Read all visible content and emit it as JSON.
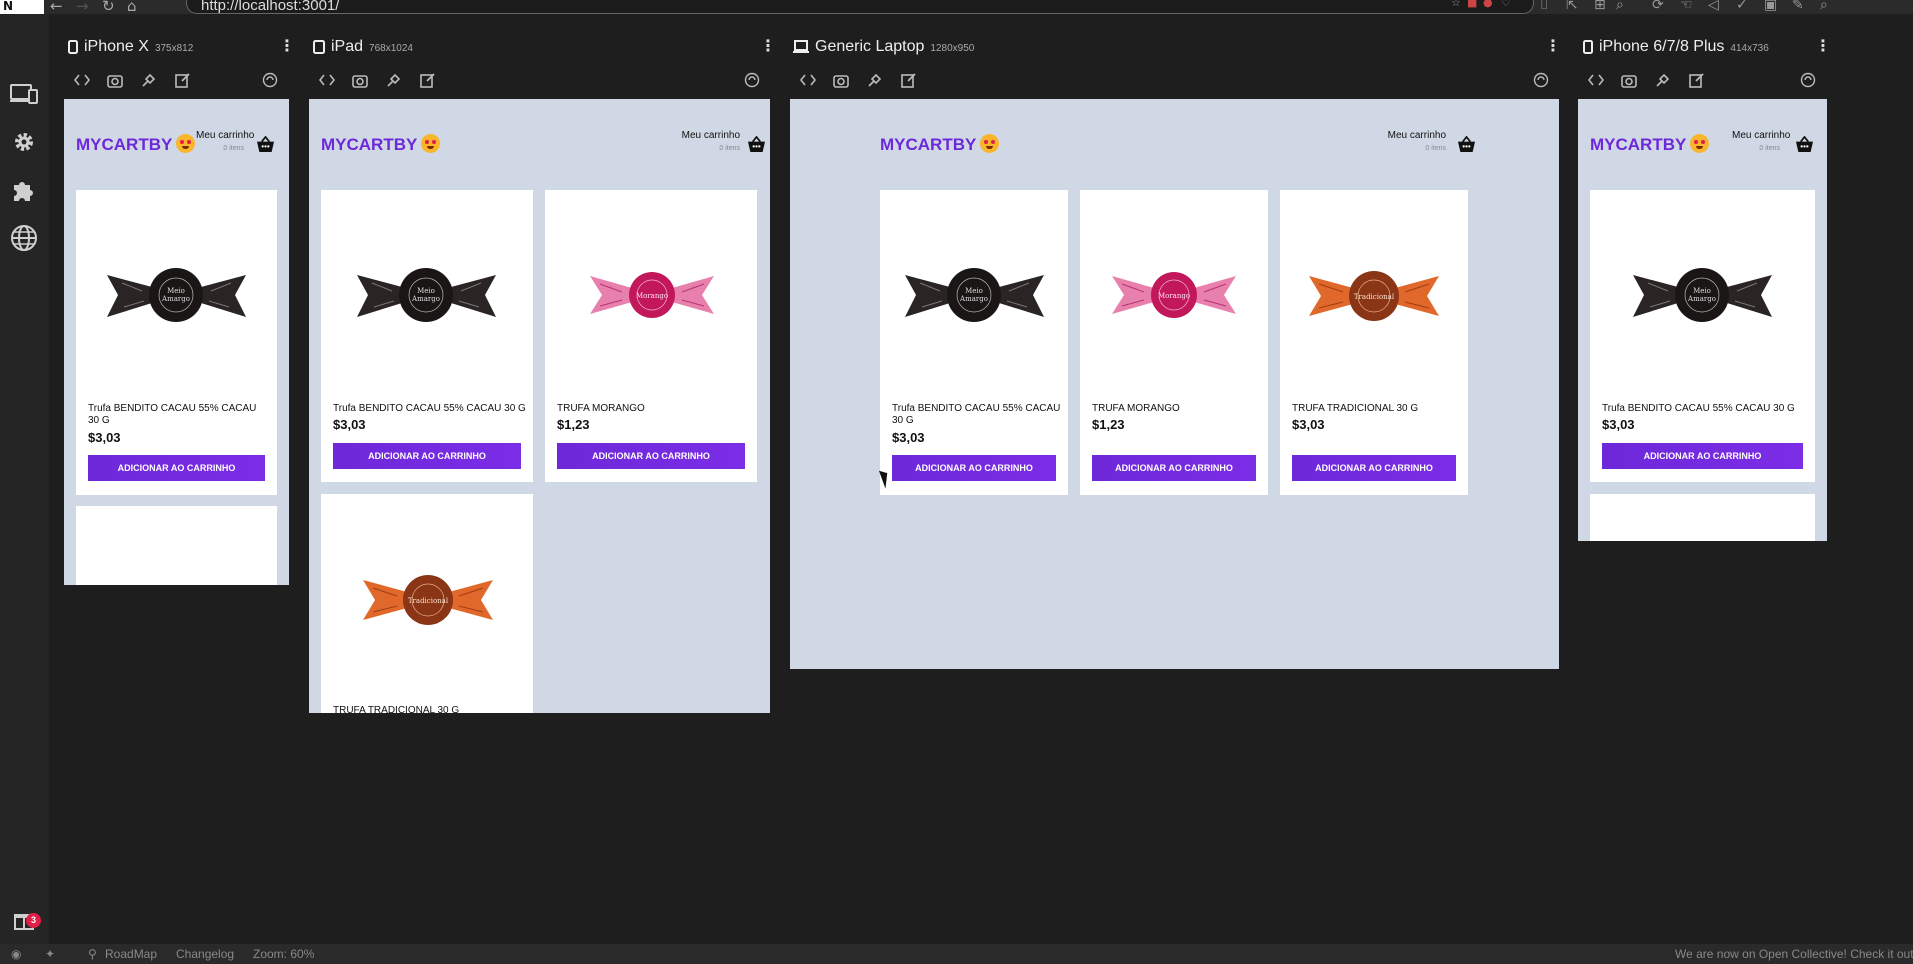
{
  "browser": {
    "url": "http://localhost:3001/",
    "logo_text": "N"
  },
  "sidebar": {
    "items": [
      {
        "icon": "devices-icon"
      },
      {
        "icon": "gear-icon"
      },
      {
        "icon": "puzzle-icon"
      },
      {
        "icon": "globe-icon"
      }
    ],
    "gift_badge": "3"
  },
  "devices": [
    {
      "name": "iPhone X",
      "size": "375x812",
      "icon": "phone-icon"
    },
    {
      "name": "iPad",
      "size": "768x1024",
      "icon": "tablet-icon"
    },
    {
      "name": "Generic Laptop",
      "size": "1280x950",
      "icon": "laptop-icon"
    },
    {
      "name": "iPhone 6/7/8 Plus",
      "size": "414x736",
      "icon": "phone-icon"
    }
  ],
  "site": {
    "brand": "MYCARTBY",
    "cart_label": "Meu carrinho",
    "cart_count": "0 itens",
    "button_label": "ADICIONAR AO CARRINHO",
    "products": [
      {
        "name": "Trufa BENDITO CACAU 55% CACAU 30 G",
        "price": "$3,03",
        "wrapper": "dark"
      },
      {
        "name": "TRUFA MORANGO",
        "price": "$1,23",
        "wrapper": "pink"
      },
      {
        "name": "TRUFA TRADICIONAL 30 G",
        "price": "$3,03",
        "wrapper": "orange"
      }
    ]
  },
  "bottombar": {
    "roadmap": "RoadMap",
    "changelog": "Changelog",
    "zoom": "Zoom: 60%",
    "message": "We are now on Open Collective! Check it out"
  },
  "colors": {
    "accent": "#6d28d9",
    "viewport_bg": "#d1d8e5",
    "app_bg": "#1e1e1e"
  }
}
